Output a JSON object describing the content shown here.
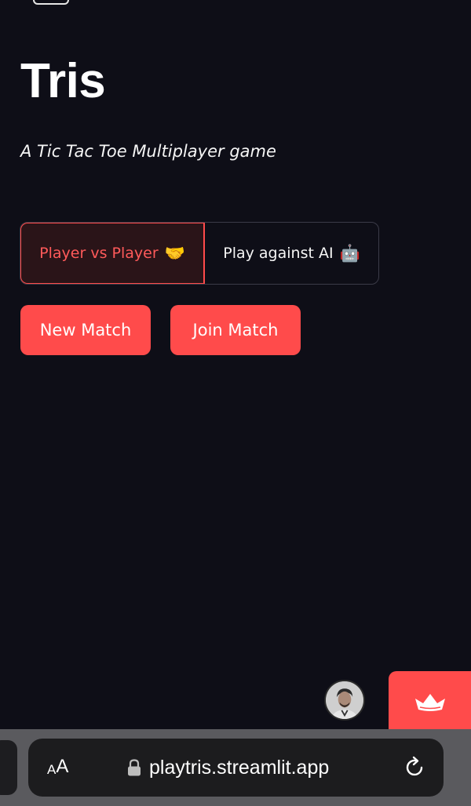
{
  "app": {
    "title": "Tris",
    "subtitle": "A Tic Tac Toe Multiplayer game"
  },
  "mode_selector": {
    "options": [
      {
        "label": "Player vs Player",
        "emoji": "🤝",
        "selected": true
      },
      {
        "label": "Play against AI",
        "emoji": "🤖",
        "selected": false
      }
    ]
  },
  "actions": {
    "new_match_label": "New Match",
    "join_match_label": "Join Match"
  },
  "browser": {
    "text_size_small": "A",
    "text_size_large": "A",
    "url": "playtris.streamlit.app"
  },
  "icons": {
    "avatar": "user-avatar",
    "badge": "streamlit-crown-icon",
    "lock": "lock-icon",
    "reload": "reload-icon"
  },
  "colors": {
    "background": "#0e0e17",
    "accent": "#ff4b4b",
    "selected_segment_bg": "#2a1418",
    "browser_bar": "#5a5a5e"
  }
}
